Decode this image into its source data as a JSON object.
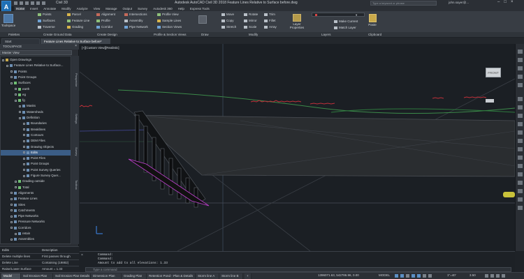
{
  "app": {
    "logo": "A",
    "workspace": "Civil 3D",
    "window_title": "Autodesk AutoCAD Civil 3D 2018   Feature Lines Relative to Surface before.dwg",
    "search_placeholder": "Type a keyword or phrase",
    "user": "john.sayer@..."
  },
  "menu": [
    "Home",
    "Insert",
    "Annotate",
    "Modify",
    "Analyze",
    "View",
    "Manage",
    "Output",
    "Survey",
    "Autodesk 360",
    "Help",
    "Express Tools"
  ],
  "ribbon": {
    "toolspace_label": "Toolspace",
    "palettes_col1": [
      "Points",
      "Surfaces",
      "Traverse"
    ],
    "create_ground": [
      "Parcel",
      "Feature Line",
      "Grading"
    ],
    "create_design_a": [
      "Alignment",
      "Profile",
      "Corridor"
    ],
    "create_design_b": [
      "Intersections",
      "Assembly",
      "Pipe Network"
    ],
    "profile_section": [
      "Profile View",
      "Sample Lines",
      "Section Views"
    ],
    "draw": [
      "Move",
      "Copy",
      "Stretch"
    ],
    "modify_a": [
      "Rotate",
      "Mirror",
      "Scale"
    ],
    "modify_b": [
      "Trim",
      "Fillet",
      "Array"
    ],
    "layers_label": "Layer Properties",
    "layers": [
      "Make Current",
      "Match Layer"
    ],
    "paste_label": "Paste",
    "panel_labels": {
      "palettes": "Palettes",
      "create_ground": "Create Ground Data",
      "create_design": "Create Design",
      "profile_section": "Profile & Section Views",
      "draw": "Draw",
      "modify": "Modify",
      "layers": "Layers",
      "clipboard": "Clipboard"
    }
  },
  "doc_tabs": [
    "Start",
    "Feature Lines Relative to Surface before*"
  ],
  "toolspace": {
    "title": "TOOLSPACE",
    "view": "Master View",
    "tree": [
      {
        "label": "Open Drawings",
        "indent": 0,
        "icon": "f"
      },
      {
        "label": "Feature Lines Relative to Surface...",
        "indent": 1,
        "icon": "d"
      },
      {
        "label": "Points",
        "indent": 2,
        "icon": "d"
      },
      {
        "label": "Point Groups",
        "indent": 2,
        "icon": "d"
      },
      {
        "label": "Surfaces",
        "indent": 2,
        "icon": "s"
      },
      {
        "label": "earth",
        "indent": 3,
        "icon": "s"
      },
      {
        "label": "eg",
        "indent": 3,
        "icon": "s"
      },
      {
        "label": "fg",
        "indent": 3,
        "icon": "s"
      },
      {
        "label": "Masks",
        "indent": 4,
        "icon": "d"
      },
      {
        "label": "Watersheds",
        "indent": 4,
        "icon": "d"
      },
      {
        "label": "Definition",
        "indent": 4,
        "icon": "d"
      },
      {
        "label": "Boundaries",
        "indent": 5,
        "icon": "d"
      },
      {
        "label": "Breaklines",
        "indent": 5,
        "icon": "d"
      },
      {
        "label": "Contours",
        "indent": 5,
        "icon": "d"
      },
      {
        "label": "DEM Files",
        "indent": 5,
        "icon": "d"
      },
      {
        "label": "Drawing Objects",
        "indent": 5,
        "icon": "d"
      },
      {
        "label": "Edits",
        "indent": 5,
        "icon": "d",
        "selected": true
      },
      {
        "label": "Point Files",
        "indent": 5,
        "icon": "d"
      },
      {
        "label": "Point Groups",
        "indent": 5,
        "icon": "d"
      },
      {
        "label": "Point Survey Queries",
        "indent": 5,
        "icon": "d"
      },
      {
        "label": "Figure Survey Quer...",
        "indent": 5,
        "icon": "d"
      },
      {
        "label": "Grading outside",
        "indent": 3,
        "icon": "s"
      },
      {
        "label": "Total",
        "indent": 3,
        "icon": "s"
      },
      {
        "label": "Alignments",
        "indent": 2,
        "icon": "d"
      },
      {
        "label": "Feature Lines",
        "indent": 2,
        "icon": "d"
      },
      {
        "label": "Sites",
        "indent": 2,
        "icon": "d"
      },
      {
        "label": "Catchments",
        "indent": 2,
        "icon": "d"
      },
      {
        "label": "Pipe Networks",
        "indent": 2,
        "icon": "d"
      },
      {
        "label": "Pressure Networks",
        "indent": 2,
        "icon": "d"
      },
      {
        "label": "Corridors",
        "indent": 2,
        "icon": "d"
      },
      {
        "label": "retain",
        "indent": 3,
        "icon": "d"
      },
      {
        "label": "Assemblies",
        "indent": 2,
        "icon": "d"
      }
    ],
    "side_tabs": [
      "Prospector",
      "Settings",
      "Survey",
      "Toolbox"
    ],
    "table": {
      "headers": [
        "Edits",
        "Description"
      ],
      "rows": [
        [
          "Delete multiple lines",
          "First passes through"
        ],
        [
          "Delete Line",
          "Containing (19882)"
        ],
        [
          "Raise/Lower Surface",
          "Amount = 1.33"
        ]
      ]
    }
  },
  "viewport": {
    "label": "[+][Custom View][Realistic]",
    "viewcube": "FRONT",
    "wcs": "WCS"
  },
  "command": {
    "lines": [
      "Command:",
      "Command:",
      "Amount to add to all elevations: 1.33"
    ],
    "placeholder": "Type a command"
  },
  "status": {
    "layout_tabs": [
      "Model",
      "Soil Erosion Plan",
      "Soil Erosion Plan Details",
      "Dimension Plan",
      "Grading Plan",
      "Retention Pond - Plan & Details",
      "Storm line A",
      "Storm line B"
    ],
    "coords": "1396071.63, 542786.96, 0.00",
    "model_label": "MODEL",
    "scale": "1\"=40'",
    "value": "3.50"
  }
}
